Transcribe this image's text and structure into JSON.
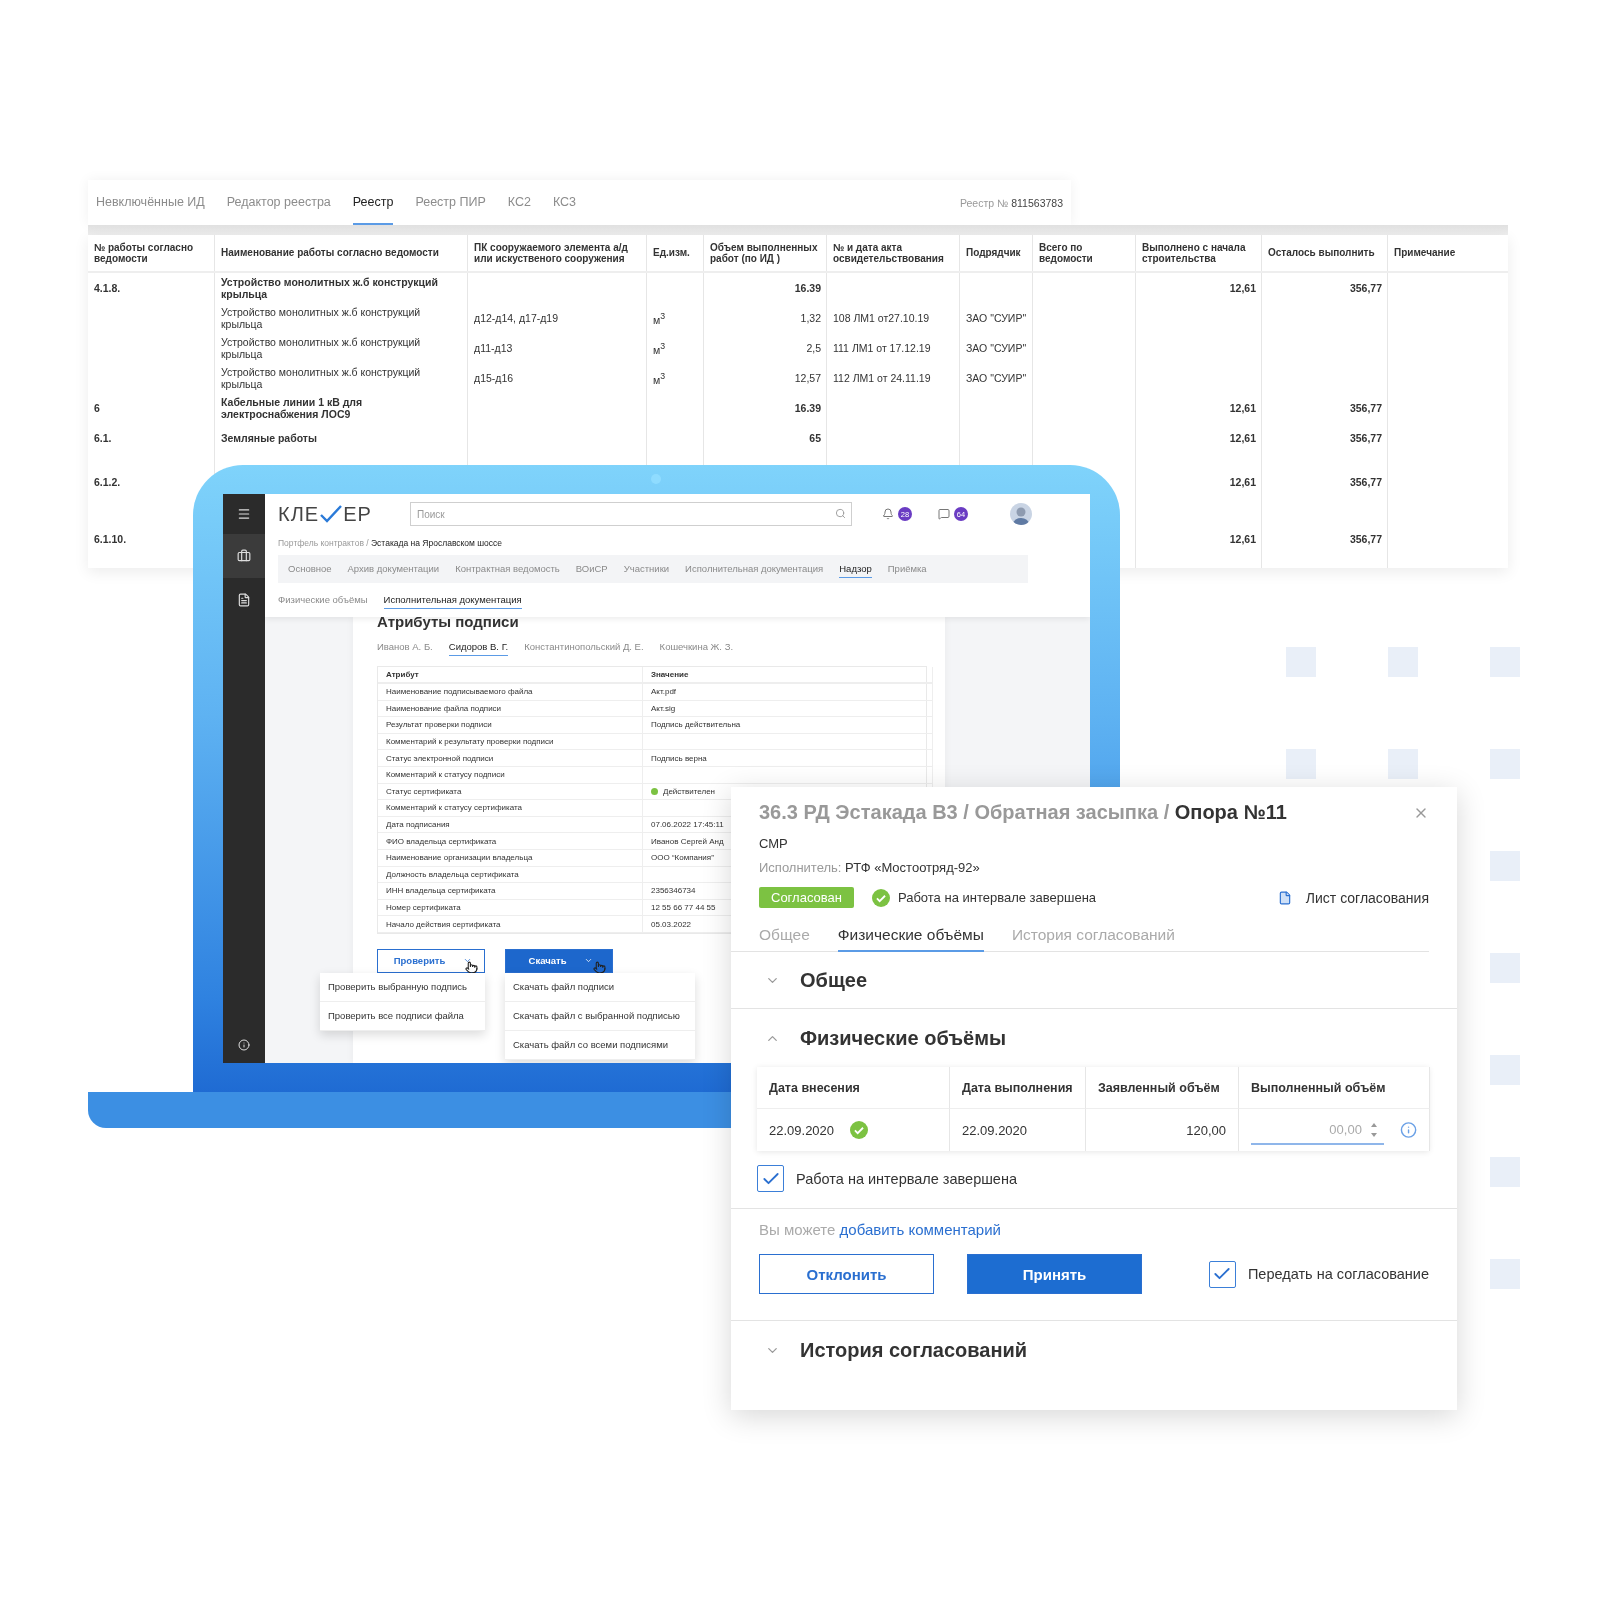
{
  "registry": {
    "tabs": [
      {
        "label": "Невключённые ИД",
        "selected": false
      },
      {
        "label": "Редактор реестра",
        "selected": false
      },
      {
        "label": "Реестр",
        "selected": true
      },
      {
        "label": "Реестр ПИР",
        "selected": false
      },
      {
        "label": "КС2",
        "selected": false
      },
      {
        "label": "КС3",
        "selected": false
      }
    ],
    "number_label": "Реестр №",
    "number": "811563783",
    "columns": [
      "№ работы согласно ведомости",
      "Наименование работы согласно ведомости",
      "ПК сооружаемого элемента а/д или искуственого сооружения",
      "Ед.изм.",
      "Объем выполненных работ (по ИД )",
      "№ и дата акта освидетельствования",
      "Подрядчик",
      "Всего по ведомости",
      "Выполнено с начала строительства",
      "Осталось выполнить",
      "Примечание"
    ],
    "rows": [
      {
        "kind": "group",
        "number": "4.1.8.",
        "name": "Устройство монолитных ж.б конструкций крыльца",
        "volume": "16.39",
        "done": "12,61",
        "remaining": "356,77"
      },
      {
        "kind": "item",
        "name": "Устройство монолитных ж.б конструкций крыльца",
        "pk": "д12-д14, д17-д19",
        "unit": "м$^{3}$",
        "volume": "1,32",
        "act": "108 ЛМ1 от27.10.19",
        "contractor": "ЗАО \"СУИР\""
      },
      {
        "kind": "item",
        "name": "Устройство монолитных ж.б конструкций крыльца",
        "pk": "д11-д13",
        "unit": "м$^{3}$",
        "volume": "2,5",
        "act": "111 ЛМ1 от 17.12.19",
        "contractor": "ЗАО \"СУИР\""
      },
      {
        "kind": "item",
        "name": "Устройство монолитных ж.б конструкций крыльца",
        "pk": "д15-д16",
        "unit": "м$^{3}$",
        "volume": "12,57",
        "act": "112 ЛМ1 от 24.11.19",
        "contractor": "ЗАО \"СУИР\""
      },
      {
        "kind": "group",
        "number": "6",
        "name": "Кабельные линии 1 кВ для электроснабжения ЛОС9",
        "volume": "16.39",
        "done": "12,61",
        "remaining": "356,77"
      },
      {
        "kind": "group",
        "number": "6.1.",
        "name": "Земляные работы",
        "volume": "65",
        "done": "12,61",
        "remaining": "356,77"
      },
      {
        "kind": "group",
        "number": "6.1.2.",
        "done": "12,61",
        "remaining": "356,77"
      },
      {
        "kind": "group",
        "number": "6.1.10.",
        "done": "12,61",
        "remaining": "356,77"
      }
    ]
  },
  "app": {
    "logo": [
      "КЛЕ",
      "ЕР"
    ],
    "search_placeholder": "Поиск",
    "notifications": "28",
    "messages": "64",
    "breadcrumb": {
      "parent": "Портфель контрактов /",
      "current": "Эстакада на Ярославском шоссе"
    },
    "tabs": [
      {
        "label": "Основное",
        "selected": false
      },
      {
        "label": "Архив документации",
        "selected": false
      },
      {
        "label": "Контрактная ведомость",
        "selected": false
      },
      {
        "label": "ВОиСР",
        "selected": false
      },
      {
        "label": "Участники",
        "selected": false
      },
      {
        "label": "Исполнительная документация",
        "selected": false
      },
      {
        "label": "Надзор",
        "selected": true
      },
      {
        "label": "Приёмка",
        "selected": false
      }
    ],
    "subtabs": [
      {
        "label": "Физические объёмы",
        "selected": false
      },
      {
        "label": "Исполнительная документация",
        "selected": true
      }
    ],
    "card": {
      "title": "Атрибуты подписи",
      "signers": [
        {
          "label": "Иванов А. Б.",
          "selected": false
        },
        {
          "label": "Сидоров В. Г.",
          "selected": true
        },
        {
          "label": "Константинопольский Д. Е.",
          "selected": false
        },
        {
          "label": "Кошечкина Ж. З.",
          "selected": false
        }
      ],
      "columns": [
        "Атрибут",
        "Значение"
      ],
      "rows": [
        {
          "attribute": "Наименование подписываемого файла",
          "value": "Акт.pdf"
        },
        {
          "attribute": "Наименование файла подписи",
          "value": "Акт.sig"
        },
        {
          "attribute": "Результат проверки подписи",
          "value": "Подпись действительна"
        },
        {
          "attribute": "Комментарий к результату проверки подписи"
        },
        {
          "attribute": "Статус электронной подписи",
          "value": "Подпись верна"
        },
        {
          "attribute": "Комментарий к статусу подписи"
        },
        {
          "attribute": "Статус сертификата",
          "value": "Действителен",
          "color": "#7cc242"
        },
        {
          "attribute": "Комментарий к статусу сертификата"
        },
        {
          "attribute": "Дата подписания",
          "value": "07.06.2022  17:45:11"
        },
        {
          "attribute": "ФИО владельца сертификата",
          "value": "Иванов Сергей Анд"
        },
        {
          "attribute": "Наименование организации владельца",
          "value": "ООО “Компания”"
        },
        {
          "attribute": "Должность владельца сертификата"
        },
        {
          "attribute": "ИНН владельца сертификата",
          "value": "2356346734"
        },
        {
          "attribute": "Номер сертификата",
          "value": "12 55 66 77 44 55"
        },
        {
          "attribute": "Начало действия сертификата",
          "value": "05.03.2022"
        }
      ]
    },
    "check_button": "Проверить",
    "download_button": "Скачать",
    "check_menu": [
      "Проверить выбранную подпись",
      "Проверить все подписи файла"
    ],
    "download_menu": [
      "Скачать файл подписи",
      "Скачать файл с выбранной подписью",
      "Скачать файл со всеми подписями"
    ]
  },
  "dialog": {
    "path": "36.3 РД Эстакада В3 / Обратная засыпка /",
    "current": "Опора №11",
    "type": "СМР",
    "executor_label": "Исполнитель:",
    "executor": "РТФ «Мостоотряд-92»",
    "status": "Согласован",
    "done_note": "Работа на интервале завершена",
    "approval_sheet": "Лист согласования",
    "tabs": [
      {
        "label": "Общее",
        "selected": false
      },
      {
        "label": "Физические объёмы",
        "selected": true
      },
      {
        "label": "История согласований",
        "selected": false
      }
    ],
    "general": {
      "title": "Общее",
      "expanded": false
    },
    "volumes": {
      "title": "Физические объёмы",
      "expanded": true,
      "columns": [
        "Дата внесения",
        "Дата выполнения",
        "Заявленный объём",
        "Выполненный объём"
      ],
      "rows": [
        {
          "entry_date": "22.09.2020",
          "confirmed": true,
          "done_date": "22.09.2020",
          "declared": "120,00",
          "performed_placeholder": "00,00"
        }
      ],
      "complete": {
        "label": "Работа на интервале завершена",
        "checked": true
      }
    },
    "comment": {
      "prefix": "Вы можете",
      "link": "добавить комментарий"
    },
    "reject_button": "Отклонить",
    "accept_button": "Принять",
    "send": {
      "label": "Передать на согласование",
      "checked": true
    },
    "history": {
      "title": "История согласований",
      "expanded": false
    }
  }
}
